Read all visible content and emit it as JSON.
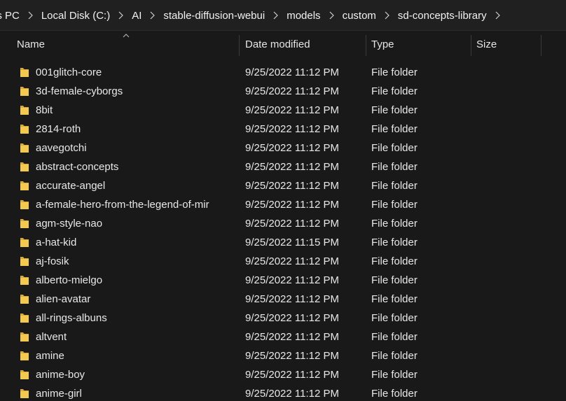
{
  "breadcrumb": [
    "is PC",
    "Local Disk (C:)",
    "AI",
    "stable-diffusion-webui",
    "models",
    "custom",
    "sd-concepts-library"
  ],
  "columns": {
    "name": "Name",
    "date": "Date modified",
    "type": "Type",
    "size": "Size"
  },
  "rows": [
    {
      "name": "001glitch-core",
      "date": "9/25/2022 11:12 PM",
      "type": "File folder",
      "size": ""
    },
    {
      "name": "3d-female-cyborgs",
      "date": "9/25/2022 11:12 PM",
      "type": "File folder",
      "size": ""
    },
    {
      "name": "8bit",
      "date": "9/25/2022 11:12 PM",
      "type": "File folder",
      "size": ""
    },
    {
      "name": "2814-roth",
      "date": "9/25/2022 11:12 PM",
      "type": "File folder",
      "size": ""
    },
    {
      "name": "aavegotchi",
      "date": "9/25/2022 11:12 PM",
      "type": "File folder",
      "size": ""
    },
    {
      "name": "abstract-concepts",
      "date": "9/25/2022 11:12 PM",
      "type": "File folder",
      "size": ""
    },
    {
      "name": "accurate-angel",
      "date": "9/25/2022 11:12 PM",
      "type": "File folder",
      "size": ""
    },
    {
      "name": "a-female-hero-from-the-legend-of-mir",
      "date": "9/25/2022 11:12 PM",
      "type": "File folder",
      "size": ""
    },
    {
      "name": "agm-style-nao",
      "date": "9/25/2022 11:12 PM",
      "type": "File folder",
      "size": ""
    },
    {
      "name": "a-hat-kid",
      "date": "9/25/2022 11:15 PM",
      "type": "File folder",
      "size": ""
    },
    {
      "name": "aj-fosik",
      "date": "9/25/2022 11:12 PM",
      "type": "File folder",
      "size": ""
    },
    {
      "name": "alberto-mielgo",
      "date": "9/25/2022 11:12 PM",
      "type": "File folder",
      "size": ""
    },
    {
      "name": "alien-avatar",
      "date": "9/25/2022 11:12 PM",
      "type": "File folder",
      "size": ""
    },
    {
      "name": "all-rings-albuns",
      "date": "9/25/2022 11:12 PM",
      "type": "File folder",
      "size": ""
    },
    {
      "name": "altvent",
      "date": "9/25/2022 11:12 PM",
      "type": "File folder",
      "size": ""
    },
    {
      "name": "amine",
      "date": "9/25/2022 11:12 PM",
      "type": "File folder",
      "size": ""
    },
    {
      "name": "anime-boy",
      "date": "9/25/2022 11:12 PM",
      "type": "File folder",
      "size": ""
    },
    {
      "name": "anime-girl",
      "date": "9/25/2022 11:12 PM",
      "type": "File folder",
      "size": ""
    }
  ],
  "icons": {
    "folder": "folder-icon",
    "separator": "chevron-right-icon",
    "sort": "sort-ascending-icon"
  },
  "colors": {
    "background": "#191919",
    "addressbar": "#202020",
    "folder_yellow": "#f3c94f",
    "text": "#e8e8e8"
  }
}
